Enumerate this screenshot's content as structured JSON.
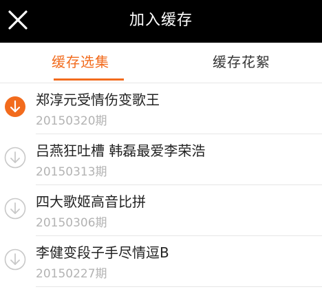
{
  "header": {
    "title": "加入缓存",
    "close_icon": "close-icon"
  },
  "tabs": [
    {
      "label": "缓存选集",
      "active": true
    },
    {
      "label": "缓存花絮",
      "active": false
    }
  ],
  "colors": {
    "accent": "#f26b1d",
    "header_bg": "#000000",
    "muted_icon": "#c8c8c8",
    "date_text": "#b3b3b3"
  },
  "episodes": [
    {
      "title": "郑淳元受情伤变歌王",
      "date": "20150320期",
      "state": "downloading",
      "icon": "download-active-icon"
    },
    {
      "title": "吕燕狂吐槽 韩磊最爱李荣浩",
      "date": "20150313期",
      "state": "available",
      "icon": "download-icon"
    },
    {
      "title": "四大歌姬高音比拼",
      "date": "20150306期",
      "state": "available",
      "icon": "download-icon"
    },
    {
      "title": "李健变段子手尽情逗B",
      "date": "20150227期",
      "state": "available",
      "icon": "download-icon"
    }
  ]
}
